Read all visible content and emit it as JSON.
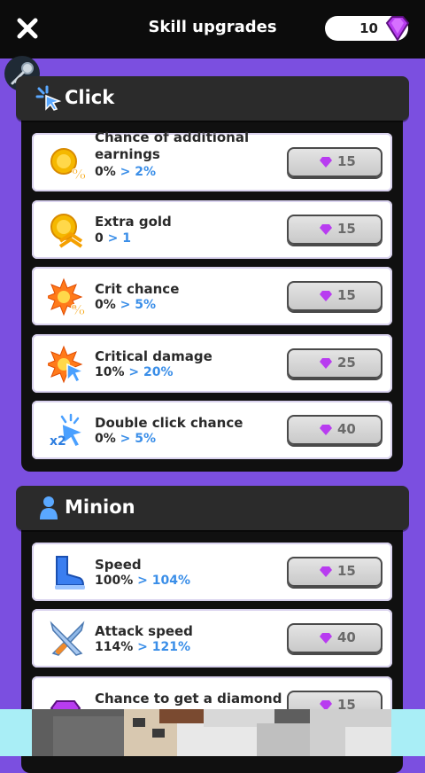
{
  "header": {
    "title": "Skill upgrades",
    "gems": "10"
  },
  "sections": [
    {
      "title": "Click",
      "items": [
        {
          "name": "Chance of additional earnings",
          "current": "0%",
          "next": "> 2%",
          "cost": "15",
          "icon": "coin-percent-icon"
        },
        {
          "name": "Extra gold",
          "current": "0",
          "next": "> 1",
          "cost": "15",
          "icon": "coin-chevron-icon"
        },
        {
          "name": "Crit chance",
          "current": "0%",
          "next": "> 5%",
          "cost": "15",
          "icon": "burst-percent-icon"
        },
        {
          "name": "Critical damage",
          "current": "10%",
          "next": "> 20%",
          "cost": "25",
          "icon": "burst-cursor-icon"
        },
        {
          "name": "Double click chance",
          "current": "0%",
          "next": "> 5%",
          "cost": "40",
          "icon": "x2-cursor-icon"
        }
      ]
    },
    {
      "title": "Minion",
      "items": [
        {
          "name": "Speed",
          "current": "100%",
          "next": "> 104%",
          "cost": "15",
          "icon": "boot-icon"
        },
        {
          "name": "Attack speed",
          "current": "114%",
          "next": "> 121%",
          "cost": "40",
          "icon": "crossed-swords-icon"
        },
        {
          "name": "Chance to get a diamond",
          "current": "",
          "next": "",
          "cost": "15",
          "icon": "diamond-percent-icon"
        }
      ]
    }
  ],
  "colors": {
    "background": "#7b4fe0",
    "accent": "#3a8ee8",
    "gem": "#b83cf0"
  }
}
